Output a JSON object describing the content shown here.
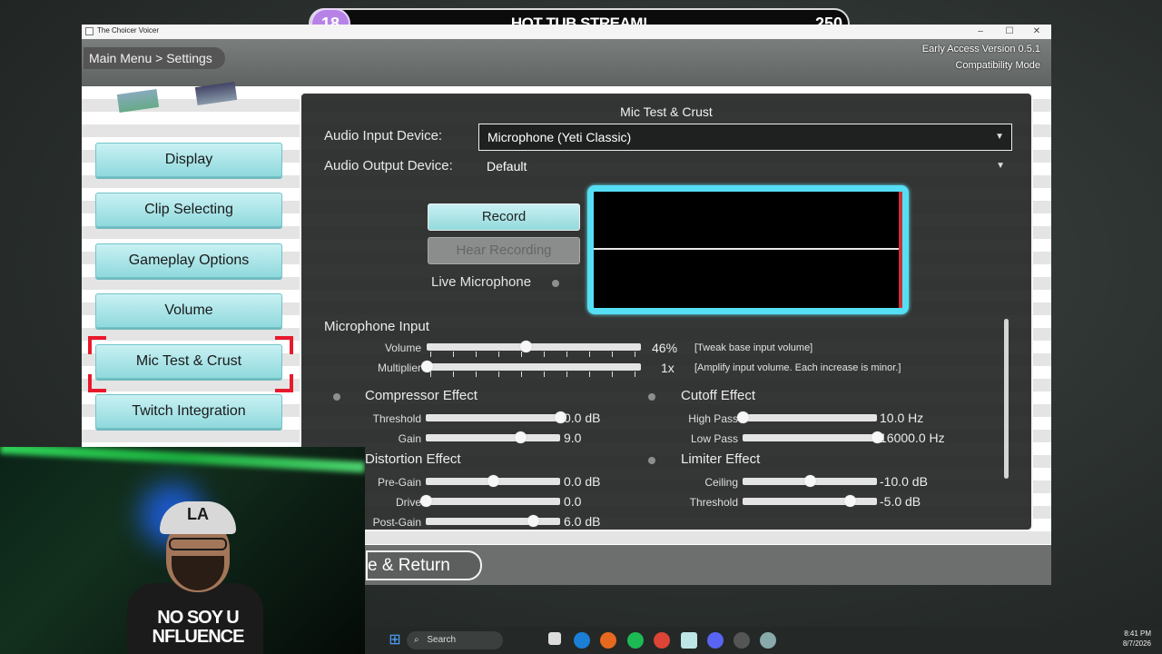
{
  "stream": {
    "count": "18",
    "title": "HOT TUB STREAM!",
    "score": "250"
  },
  "window": {
    "title": "The Choicer Voicer",
    "breadcrumb": "Main Menu > Settings",
    "version_line1": "Early Access Version 0.5.1",
    "version_line2": "Compatibility Mode"
  },
  "sidebar": {
    "items": [
      {
        "label": "Display"
      },
      {
        "label": "Clip Selecting"
      },
      {
        "label": "Gameplay Options"
      },
      {
        "label": "Volume"
      },
      {
        "label": "Mic Test & Crust",
        "selected": true
      },
      {
        "label": "Twitch Integration"
      }
    ]
  },
  "panel": {
    "title": "Mic Test & Crust",
    "input_label": "Audio Input Device:",
    "input_value": "Microphone (Yeti Classic)",
    "output_label": "Audio Output Device:",
    "output_value": "Default",
    "record_label": "Record",
    "hear_label": "Hear Recording",
    "live_mic_label": "Live Microphone",
    "mic_input": {
      "title": "Microphone Input",
      "volume_label": "Volume",
      "volume_value": "46%",
      "volume_fraction": 0.46,
      "volume_note": "[Tweak base input volume]",
      "multiplier_label": "Multiplier",
      "multiplier_value": "1x",
      "multiplier_fraction": 0,
      "multiplier_note": "[Amplify input volume. Each increase is minor.]"
    },
    "compressor": {
      "title": "Compressor Effect",
      "threshold_label": "Threshold",
      "threshold_value": "0.0 dB",
      "threshold_fraction": 1.0,
      "gain_label": "Gain",
      "gain_value": "9.0",
      "gain_fraction": 0.7
    },
    "cutoff": {
      "title": "Cutoff Effect",
      "highpass_label": "High Pass",
      "highpass_value": "10.0 Hz",
      "highpass_fraction": 0.0,
      "lowpass_label": "Low Pass",
      "lowpass_value": "16000.0 Hz",
      "lowpass_fraction": 1.0
    },
    "distortion": {
      "title": "Distortion Effect",
      "pregain_label": "Pre-Gain",
      "pregain_value": "0.0 dB",
      "pregain_fraction": 0.5,
      "drive_label": "Drive",
      "drive_value": "0.0",
      "drive_fraction": 0.0,
      "postgain_label": "Post-Gain",
      "postgain_value": "6.0 dB",
      "postgain_fraction": 0.8
    },
    "limiter": {
      "title": "Limiter Effect",
      "ceiling_label": "Ceiling",
      "ceiling_value": "-10.0 dB",
      "ceiling_fraction": 0.5,
      "threshold_label": "Threshold",
      "threshold_value": "-5.0 dB",
      "threshold_fraction": 0.8
    }
  },
  "footer": {
    "return_label": "e & Return"
  },
  "webcam": {
    "cap_text": "LA",
    "shirt_line1": "NO SOY U",
    "shirt_line2": "NFLUENCE"
  },
  "taskbar": {
    "search_label": "Search",
    "time": "8:41 PM",
    "date": "8/7/2026"
  },
  "colors": {
    "accent_cyan": "#55dff5",
    "button_cyan": "#a9e6e9",
    "selection_red": "#e8192c"
  }
}
